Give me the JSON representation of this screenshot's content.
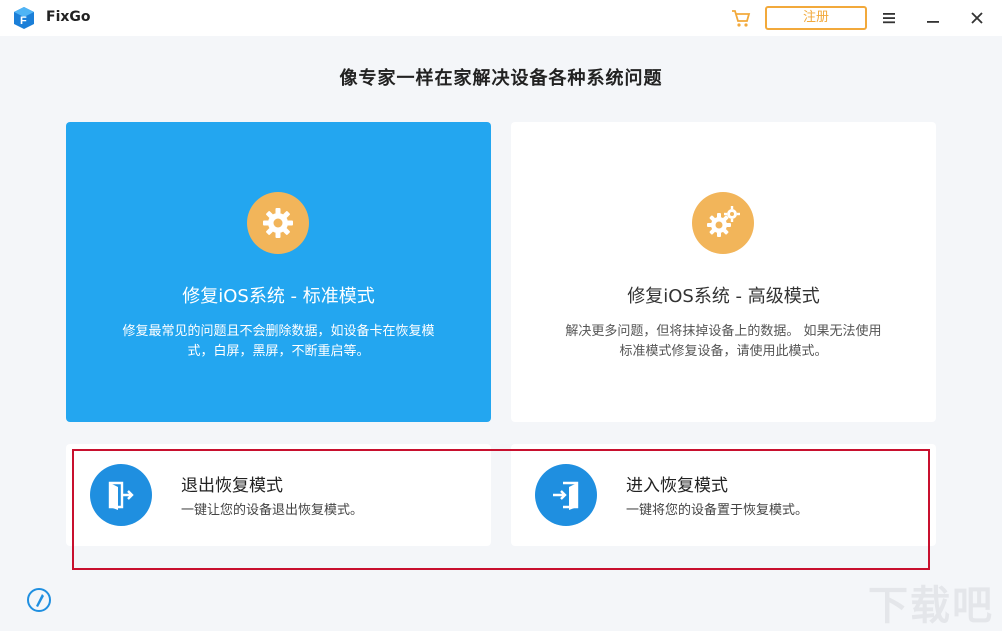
{
  "app": {
    "name": "FixGo"
  },
  "titlebar": {
    "register_label": "注册"
  },
  "headline": "像专家一样在家解决设备各种系统问题",
  "modes": [
    {
      "title": "修复iOS系统 - 标准模式",
      "desc_line1": "修复最常见的问题且不会删除数据，如设备卡在恢复模",
      "desc_line2": "式，白屏，黑屏，不断重启等。"
    },
    {
      "title": "修复iOS系统 - 高级模式",
      "desc_line1": "解决更多问题，但将抹掉设备上的数据。 如果无法使用",
      "desc_line2": "标准模式修复设备，请使用此模式。"
    }
  ],
  "recovery": [
    {
      "title": "退出恢复模式",
      "desc": "一键让您的设备退出恢复模式。"
    },
    {
      "title": "进入恢复模式",
      "desc": "一键将您的设备置于恢复模式。"
    }
  ],
  "watermark": "下载吧",
  "colors": {
    "accent_blue": "#23a6f0",
    "icon_orange": "#f2b55a",
    "highlight_red": "#c8102e"
  }
}
